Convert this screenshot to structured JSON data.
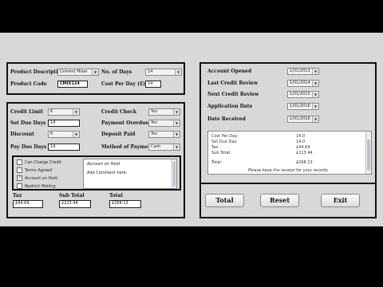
{
  "product": {
    "description_label": "Product Description",
    "description_value": "Cement Mixer",
    "code_label": "Product Code",
    "code_value": "CMIX124",
    "days_label": "No. of Days",
    "days_value": "14",
    "cost_label": "Cost Per Day (£)",
    "cost_value": "14"
  },
  "credit": {
    "limit_label": "Credit Limit",
    "limit_value": "6",
    "set_due_label": "Set Due Days",
    "set_due_value": "14",
    "discount_label": "Discount",
    "discount_value": "6",
    "pay_due_label": "Pay Due Days",
    "pay_due_value": "14",
    "check_label": "Credit Check",
    "check_value": "Yes",
    "overdue_label": "Payment Overdue",
    "overdue_value": "Yes",
    "deposit_label": "Deposit Paid",
    "deposit_value": "Yes",
    "method_label": "Method of Payment",
    "method_value": "Cash"
  },
  "options": {
    "checkboxes": [
      {
        "label": "Can Charge Credit",
        "checked": false
      },
      {
        "label": "Terms Agreed",
        "checked": false
      },
      {
        "label": "Account on Hold",
        "checked": true
      },
      {
        "label": "Restrict Mailing",
        "checked": false
      }
    ],
    "comment_line1": "Account on Hold",
    "comment_line2": "Add Comment here:"
  },
  "totals": {
    "tax_label": "Tax",
    "tax_value": "£44.69",
    "subtotal_label": "Sub Total",
    "subtotal_value": "£223.44",
    "total_label": "Total",
    "total_value": "£268.13"
  },
  "dates": {
    "opened_label": "Account Opened",
    "opened_value": "1/01/2013",
    "last_review_label": "Last Credit Review",
    "last_review_value": "1/01/2014",
    "next_review_label": "Next Credit Review",
    "next_review_value": "1/01/2015",
    "application_label": "Application Date",
    "application_value": "1/01/2016",
    "received_label": "Date Received",
    "received_value": "1/01/2016"
  },
  "receipt": {
    "rows": [
      {
        "k": "Cost Per Day:",
        "v": "14.0"
      },
      {
        "k": "Set Due Day:",
        "v": "14.0"
      },
      {
        "k": "Tax:",
        "v": "£44.69"
      },
      {
        "k": "Sub Total:",
        "v": "£223.44"
      },
      {
        "k": "Total:",
        "v": "£268.13"
      }
    ],
    "footer": "Please keep the receipt for your records"
  },
  "buttons": {
    "total": "Total",
    "reset": "Reset",
    "exit": "Exit"
  }
}
